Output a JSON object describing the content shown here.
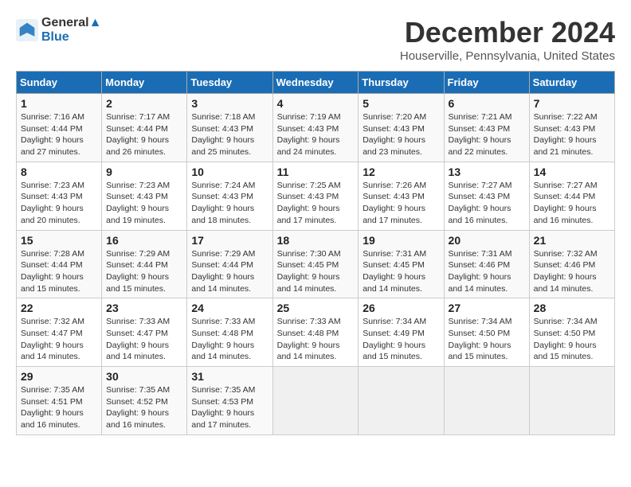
{
  "logo": {
    "line1": "General",
    "line2": "Blue"
  },
  "title": "December 2024",
  "subtitle": "Houserville, Pennsylvania, United States",
  "days_of_week": [
    "Sunday",
    "Monday",
    "Tuesday",
    "Wednesday",
    "Thursday",
    "Friday",
    "Saturday"
  ],
  "weeks": [
    [
      {
        "day": "1",
        "info": "Sunrise: 7:16 AM\nSunset: 4:44 PM\nDaylight: 9 hours and 27 minutes."
      },
      {
        "day": "2",
        "info": "Sunrise: 7:17 AM\nSunset: 4:44 PM\nDaylight: 9 hours and 26 minutes."
      },
      {
        "day": "3",
        "info": "Sunrise: 7:18 AM\nSunset: 4:43 PM\nDaylight: 9 hours and 25 minutes."
      },
      {
        "day": "4",
        "info": "Sunrise: 7:19 AM\nSunset: 4:43 PM\nDaylight: 9 hours and 24 minutes."
      },
      {
        "day": "5",
        "info": "Sunrise: 7:20 AM\nSunset: 4:43 PM\nDaylight: 9 hours and 23 minutes."
      },
      {
        "day": "6",
        "info": "Sunrise: 7:21 AM\nSunset: 4:43 PM\nDaylight: 9 hours and 22 minutes."
      },
      {
        "day": "7",
        "info": "Sunrise: 7:22 AM\nSunset: 4:43 PM\nDaylight: 9 hours and 21 minutes."
      }
    ],
    [
      {
        "day": "8",
        "info": "Sunrise: 7:23 AM\nSunset: 4:43 PM\nDaylight: 9 hours and 20 minutes."
      },
      {
        "day": "9",
        "info": "Sunrise: 7:23 AM\nSunset: 4:43 PM\nDaylight: 9 hours and 19 minutes."
      },
      {
        "day": "10",
        "info": "Sunrise: 7:24 AM\nSunset: 4:43 PM\nDaylight: 9 hours and 18 minutes."
      },
      {
        "day": "11",
        "info": "Sunrise: 7:25 AM\nSunset: 4:43 PM\nDaylight: 9 hours and 17 minutes."
      },
      {
        "day": "12",
        "info": "Sunrise: 7:26 AM\nSunset: 4:43 PM\nDaylight: 9 hours and 17 minutes."
      },
      {
        "day": "13",
        "info": "Sunrise: 7:27 AM\nSunset: 4:43 PM\nDaylight: 9 hours and 16 minutes."
      },
      {
        "day": "14",
        "info": "Sunrise: 7:27 AM\nSunset: 4:44 PM\nDaylight: 9 hours and 16 minutes."
      }
    ],
    [
      {
        "day": "15",
        "info": "Sunrise: 7:28 AM\nSunset: 4:44 PM\nDaylight: 9 hours and 15 minutes."
      },
      {
        "day": "16",
        "info": "Sunrise: 7:29 AM\nSunset: 4:44 PM\nDaylight: 9 hours and 15 minutes."
      },
      {
        "day": "17",
        "info": "Sunrise: 7:29 AM\nSunset: 4:44 PM\nDaylight: 9 hours and 14 minutes."
      },
      {
        "day": "18",
        "info": "Sunrise: 7:30 AM\nSunset: 4:45 PM\nDaylight: 9 hours and 14 minutes."
      },
      {
        "day": "19",
        "info": "Sunrise: 7:31 AM\nSunset: 4:45 PM\nDaylight: 9 hours and 14 minutes."
      },
      {
        "day": "20",
        "info": "Sunrise: 7:31 AM\nSunset: 4:46 PM\nDaylight: 9 hours and 14 minutes."
      },
      {
        "day": "21",
        "info": "Sunrise: 7:32 AM\nSunset: 4:46 PM\nDaylight: 9 hours and 14 minutes."
      }
    ],
    [
      {
        "day": "22",
        "info": "Sunrise: 7:32 AM\nSunset: 4:47 PM\nDaylight: 9 hours and 14 minutes."
      },
      {
        "day": "23",
        "info": "Sunrise: 7:33 AM\nSunset: 4:47 PM\nDaylight: 9 hours and 14 minutes."
      },
      {
        "day": "24",
        "info": "Sunrise: 7:33 AM\nSunset: 4:48 PM\nDaylight: 9 hours and 14 minutes."
      },
      {
        "day": "25",
        "info": "Sunrise: 7:33 AM\nSunset: 4:48 PM\nDaylight: 9 hours and 14 minutes."
      },
      {
        "day": "26",
        "info": "Sunrise: 7:34 AM\nSunset: 4:49 PM\nDaylight: 9 hours and 15 minutes."
      },
      {
        "day": "27",
        "info": "Sunrise: 7:34 AM\nSunset: 4:50 PM\nDaylight: 9 hours and 15 minutes."
      },
      {
        "day": "28",
        "info": "Sunrise: 7:34 AM\nSunset: 4:50 PM\nDaylight: 9 hours and 15 minutes."
      }
    ],
    [
      {
        "day": "29",
        "info": "Sunrise: 7:35 AM\nSunset: 4:51 PM\nDaylight: 9 hours and 16 minutes."
      },
      {
        "day": "30",
        "info": "Sunrise: 7:35 AM\nSunset: 4:52 PM\nDaylight: 9 hours and 16 minutes."
      },
      {
        "day": "31",
        "info": "Sunrise: 7:35 AM\nSunset: 4:53 PM\nDaylight: 9 hours and 17 minutes."
      },
      null,
      null,
      null,
      null
    ]
  ]
}
